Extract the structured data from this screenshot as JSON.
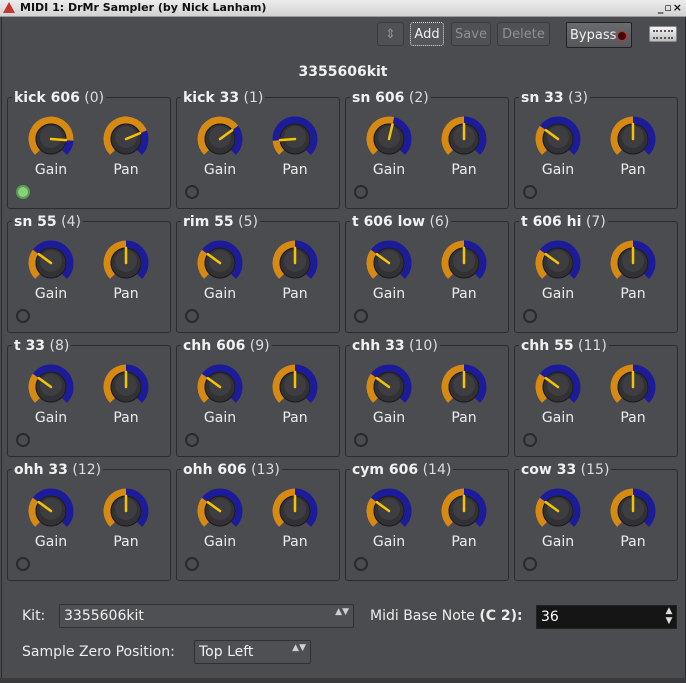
{
  "window": {
    "title": "MIDI 1: DrMr Sampler (by Nick Lanham)",
    "controls": "_▫×"
  },
  "toolbar": {
    "stepper_glyph": "⇕",
    "add_label": "Add",
    "save_label": "Save",
    "delete_label": "Delete",
    "bypass_label": "Bypass"
  },
  "kit_title": "3355606kit",
  "knob_labels": {
    "gain": "Gain",
    "pan": "Pan"
  },
  "colors": {
    "knob_ring": "#d68a12",
    "knob_value": "#1c1c9a",
    "pointer": "#f5c400",
    "led_on": "#88d07a"
  },
  "samples": [
    {
      "name": "kick 606",
      "index": "(0)",
      "gain": 0.85,
      "pan": 0.75,
      "active": true
    },
    {
      "name": "kick 33",
      "index": "(1)",
      "gain": 0.7,
      "pan": 0.15,
      "active": false
    },
    {
      "name": "sn 606",
      "index": "(2)",
      "gain": 0.55,
      "pan": 0.5,
      "active": false
    },
    {
      "name": "sn 33",
      "index": "(3)",
      "gain": 0.3,
      "pan": 0.5,
      "active": false
    },
    {
      "name": "sn 55",
      "index": "(4)",
      "gain": 0.3,
      "pan": 0.5,
      "active": false
    },
    {
      "name": "rim 55",
      "index": "(5)",
      "gain": 0.3,
      "pan": 0.5,
      "active": false
    },
    {
      "name": "t 606 low",
      "index": "(6)",
      "gain": 0.3,
      "pan": 0.5,
      "active": false
    },
    {
      "name": "t 606 hi",
      "index": "(7)",
      "gain": 0.3,
      "pan": 0.5,
      "active": false
    },
    {
      "name": "t 33",
      "index": "(8)",
      "gain": 0.3,
      "pan": 0.5,
      "active": false
    },
    {
      "name": "chh 606",
      "index": "(9)",
      "gain": 0.3,
      "pan": 0.5,
      "active": false
    },
    {
      "name": "chh 33",
      "index": "(10)",
      "gain": 0.3,
      "pan": 0.5,
      "active": false
    },
    {
      "name": "chh 55",
      "index": "(11)",
      "gain": 0.3,
      "pan": 0.5,
      "active": false
    },
    {
      "name": "ohh 33",
      "index": "(12)",
      "gain": 0.3,
      "pan": 0.5,
      "active": false
    },
    {
      "name": "ohh 606",
      "index": "(13)",
      "gain": 0.3,
      "pan": 0.5,
      "active": false
    },
    {
      "name": "cym 606",
      "index": "(14)",
      "gain": 0.3,
      "pan": 0.5,
      "active": false
    },
    {
      "name": "cow 33",
      "index": "(15)",
      "gain": 0.3,
      "pan": 0.5,
      "active": false
    }
  ],
  "footer": {
    "kit_label": "Kit:",
    "kit_value": "3355606kit",
    "combo_arrows": "▲▼",
    "base_note_label": "Midi Base Note",
    "base_note_name": "(C 2):",
    "base_note_value": "36",
    "zero_pos_label": "Sample Zero Position:",
    "zero_pos_value": "Top Left"
  }
}
